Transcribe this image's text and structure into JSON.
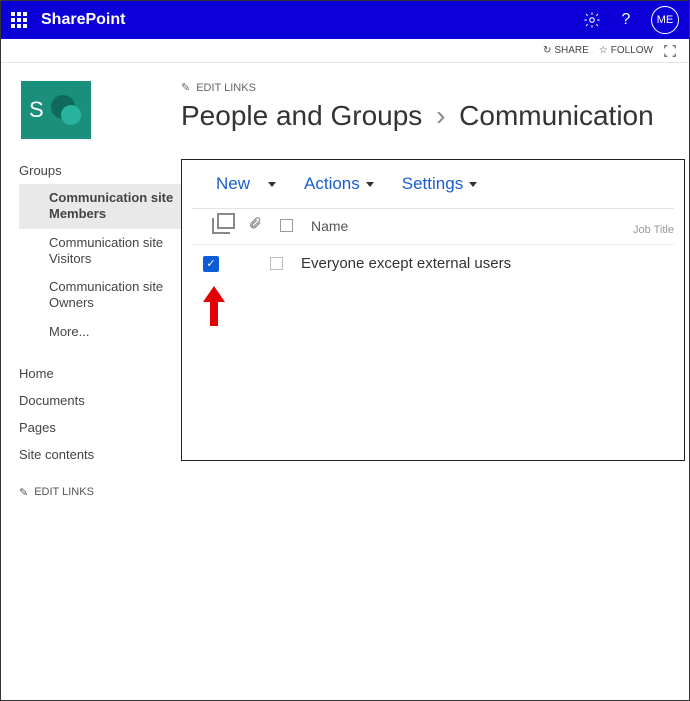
{
  "suite": {
    "brand": "SharePoint",
    "avatar_text": "ME"
  },
  "subbar": {
    "share_label": "SHARE",
    "follow_label": "FOLLOW"
  },
  "header": {
    "edit_links_label": "EDIT LINKS",
    "page_title_left": "People and Groups",
    "page_title_right": "Communication",
    "site_logo_letter": "S"
  },
  "sidebar": {
    "groups_label": "Groups",
    "items": [
      {
        "label": "Communication site Members",
        "active": true
      },
      {
        "label": "Communication site Visitors",
        "active": false
      },
      {
        "label": "Communication site Owners",
        "active": false
      },
      {
        "label": "More...",
        "active": false
      }
    ],
    "nav": {
      "home": "Home",
      "documents": "Documents",
      "pages": "Pages",
      "site_contents": "Site contents"
    },
    "edit_links_label": "EDIT LINKS"
  },
  "ribbon": {
    "new_label": "New",
    "actions_label": "Actions",
    "settings_label": "Settings"
  },
  "table": {
    "headers": {
      "name": "Name",
      "job_title": "Job Title"
    },
    "rows": [
      {
        "checked": true,
        "name": "Everyone except external users"
      }
    ]
  }
}
